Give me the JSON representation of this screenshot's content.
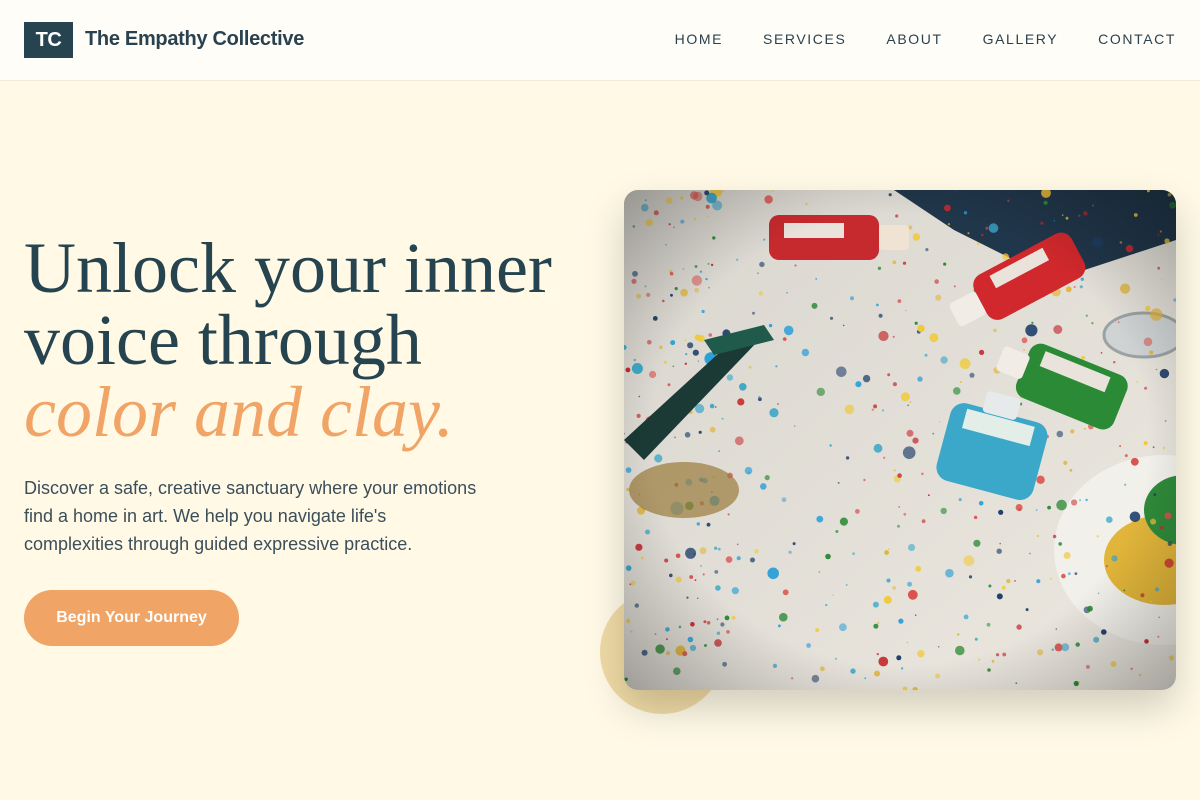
{
  "header": {
    "logo_text": "TC",
    "brand_name": "The Empathy Collective",
    "nav": [
      "HOME",
      "SERVICES",
      "ABOUT",
      "GALLERY",
      "CONTACT"
    ]
  },
  "hero": {
    "headline_line1": "Unlock your inner",
    "headline_line2": "voice through",
    "headline_accent": "color and clay.",
    "description": "Discover a safe, creative sanctuary where your emotions find a home in art. We help you navigate life's complexities through guided expressive practice.",
    "cta_label": "Begin Your Journey"
  },
  "colors": {
    "background": "#fff9e6",
    "primary": "#26444f",
    "accent": "#f0a466",
    "blob": "#f0dba6"
  },
  "image": {
    "subject": "paint-splattered table with acrylic paint bottles"
  }
}
